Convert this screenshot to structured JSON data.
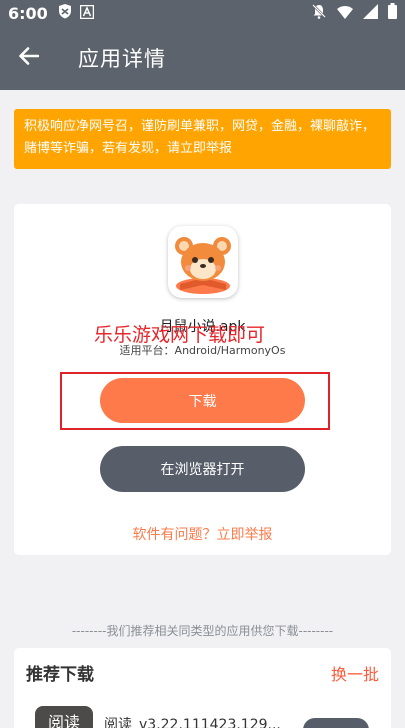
{
  "status_bar": {
    "time": "6:00",
    "left_icons": [
      "shield-icon",
      "text-a-icon"
    ],
    "right_icons": [
      "notifications-off-icon",
      "wifi-icon",
      "signal-icon",
      "battery-icon"
    ]
  },
  "app_bar": {
    "back_icon": "arrow-left-icon",
    "title": "应用详情"
  },
  "warning": {
    "text": "积极响应净网号召，谨防刷单兼职，网贷，金融，裸聊敲诈，赌博等诈骗，若有发现，请立即举报",
    "background": "#ffa400"
  },
  "app": {
    "name": "月鼠小说.apk",
    "platform": "适用平台：Android/HarmonyOs",
    "watermark": "乐乐游戏网下载即可"
  },
  "actions": {
    "download_label": "下载",
    "browser_label": "在浏览器打开",
    "report_label": "软件有问题？立即举报"
  },
  "recommend": {
    "divider_text": "--------我们推荐相关同类型的应用供您下载--------",
    "title": "推荐下载",
    "refresh_label": "换一批",
    "items": [
      {
        "icon_text": "阅读",
        "name": "阅读_v3.22.111423.129..."
      }
    ]
  },
  "colors": {
    "header": "#5d636c",
    "accent": "#ff7a4b",
    "dark_button": "#575e69",
    "highlight": "#e02328"
  }
}
